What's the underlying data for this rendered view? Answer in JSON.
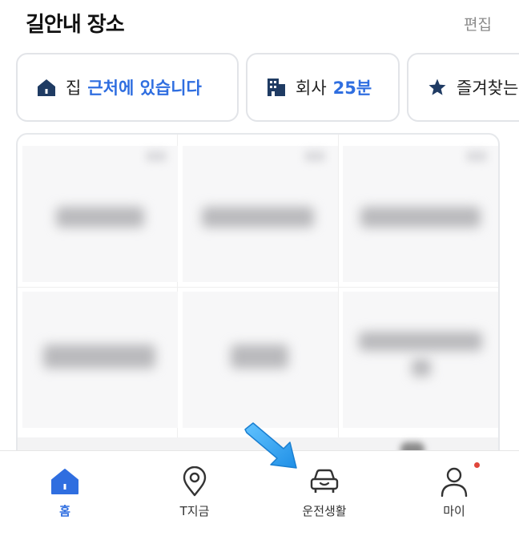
{
  "header": {
    "title": "길안내 장소",
    "edit_label": "편집"
  },
  "chips": [
    {
      "label": "집",
      "sub": "근처에 있습니다",
      "icon": "home-icon"
    },
    {
      "label": "회사",
      "sub": "25분",
      "icon": "building-icon"
    },
    {
      "label": "즐겨찾는",
      "sub": "",
      "icon": "star-icon"
    }
  ],
  "tabs": [
    {
      "label": "홈",
      "icon": "home-icon",
      "active": true
    },
    {
      "label": "T지금",
      "icon": "location-pin-icon",
      "active": false
    },
    {
      "label": "운전생활",
      "icon": "car-icon",
      "active": false
    },
    {
      "label": "마이",
      "icon": "person-icon",
      "active": false,
      "badge": true
    }
  ],
  "colors": {
    "accent": "#2f6ee0",
    "badge": "#e0463b",
    "arrow": "#39a7f0"
  }
}
